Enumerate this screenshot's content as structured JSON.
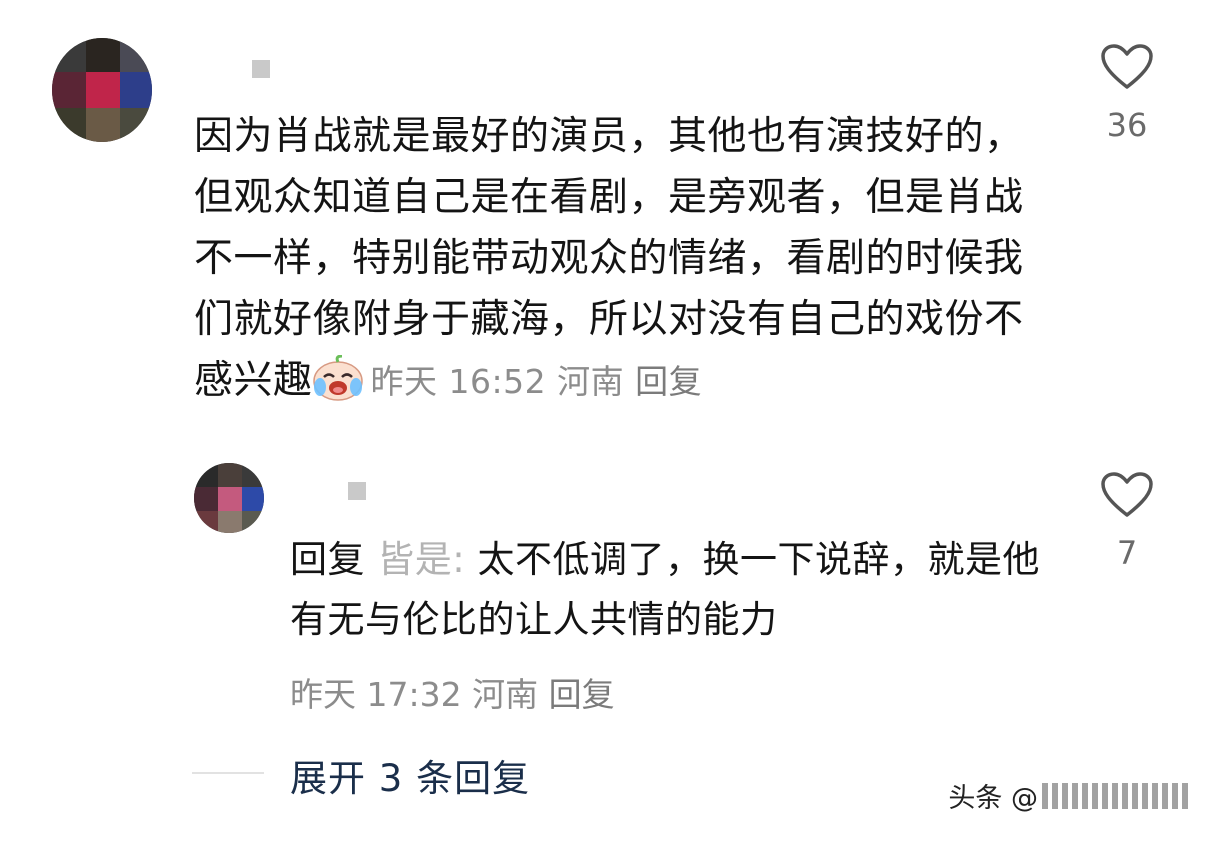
{
  "comment": {
    "text": "因为肖战就是最好的演员，其他也有演技好的，但观众知道自己是在看剧，是旁观者，但是肖战不一样，特别能带动观众的情绪，看剧的时候我们就好像附身于藏海，所以对没有自己的戏份不感兴趣",
    "emoji_icon": "crying-laugh-emoji-icon",
    "time": "昨天 16:52",
    "location": "河南",
    "reply_label": "回复",
    "likes": "36"
  },
  "reply": {
    "prefix": "回复",
    "target": "皆是:",
    "text": "太不低调了，换一下说辞，就是他有无与伦比的让人共情的能力",
    "time": "昨天 17:32",
    "location": "河南",
    "reply_label": "回复",
    "likes": "7"
  },
  "expand_label": "展开 3 条回复",
  "watermark": "头条 @"
}
